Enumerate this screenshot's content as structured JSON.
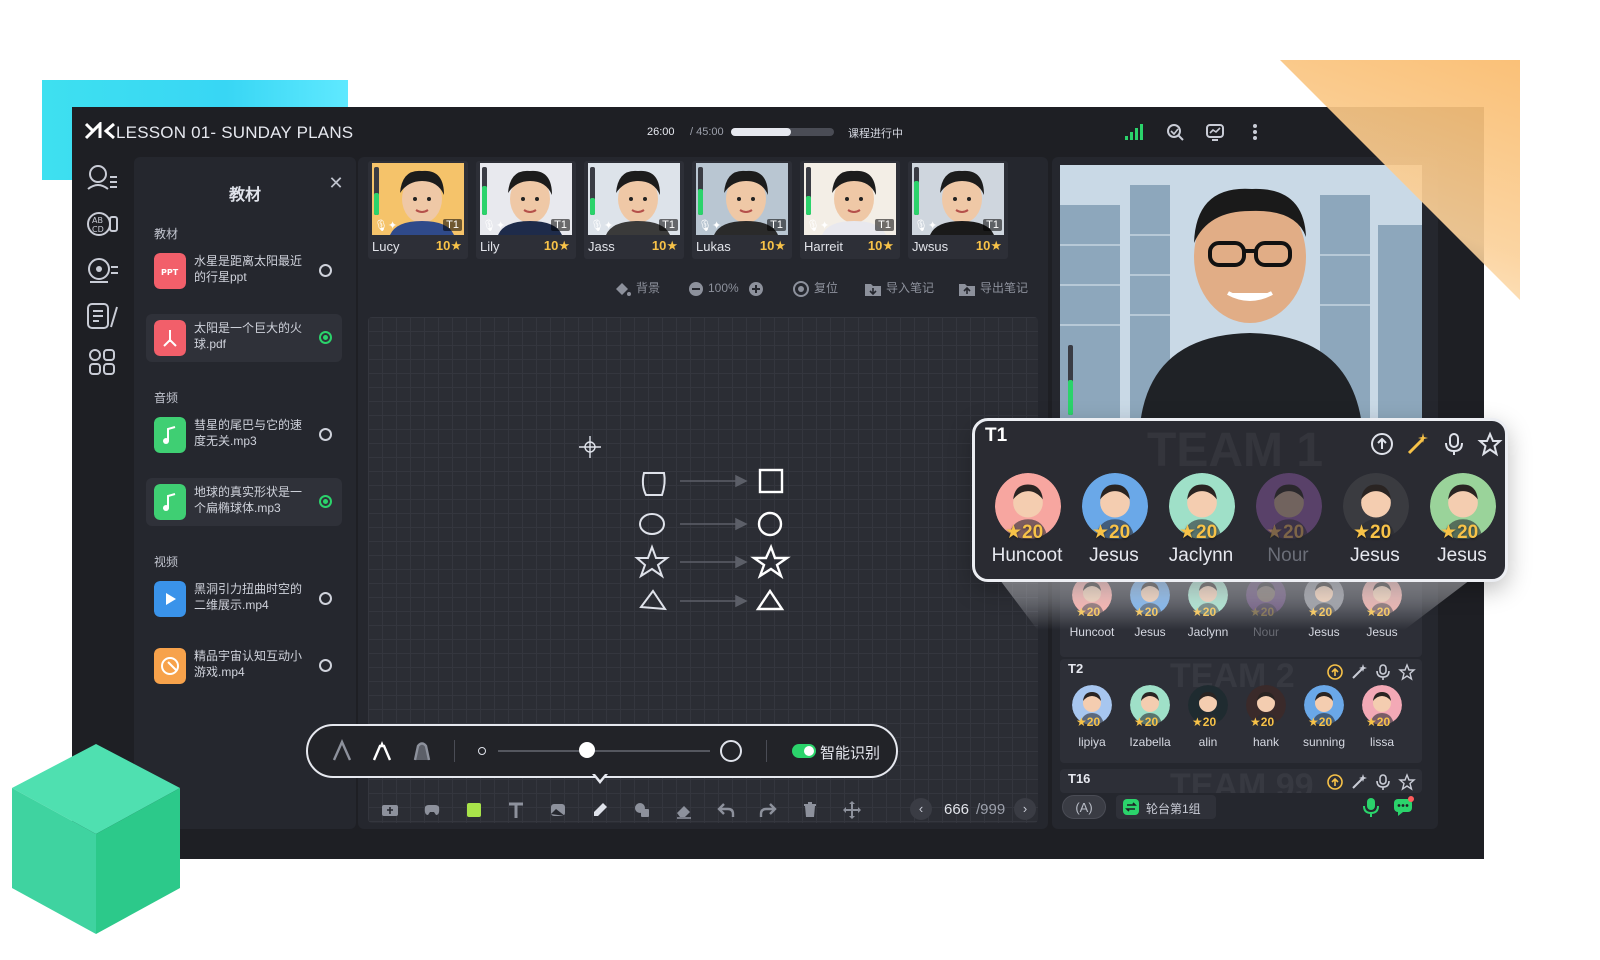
{
  "window": {
    "title": "LESSON 01- SUNDAY PLANS",
    "time_elapsed": "26:00",
    "time_total": "/ 45:00",
    "progress": 0.58,
    "status": "课程进行中"
  },
  "rail": {
    "icons": [
      "students-list-icon",
      "vocabulary-icon",
      "audio-settings-icon",
      "notes-edit-icon",
      "apps-grid-icon"
    ]
  },
  "materials_panel": {
    "title": "教材",
    "sections": [
      {
        "label": "教材",
        "items": [
          {
            "name": "水星是距离太阳最近的行星ppt",
            "type": "ppt",
            "selected": false
          },
          {
            "name": "太阳是一个巨大的火球.pdf",
            "type": "pdf",
            "selected": true
          }
        ]
      },
      {
        "label": "音频",
        "items": [
          {
            "name": "彗星的尾巴与它的速度无关.mp3",
            "type": "audio",
            "selected": false
          },
          {
            "name": "地球的真实形状是一个扁椭球体.mp3",
            "type": "audio",
            "selected": true
          }
        ]
      },
      {
        "label": "视频",
        "items": [
          {
            "name": "黑洞引力扭曲时空的二维展示.mp4",
            "type": "video",
            "selected": false
          },
          {
            "name": "精品宇宙认知互动小游戏.mp4",
            "type": "game",
            "selected": false
          }
        ]
      }
    ]
  },
  "students": [
    {
      "name": "Lucy",
      "score": "10",
      "team": "T1",
      "level": 0.45
    },
    {
      "name": "Lily",
      "score": "10",
      "team": "T1",
      "level": 0.6
    },
    {
      "name": "Jass",
      "score": "10",
      "team": "T1",
      "level": 0.35
    },
    {
      "name": "Lukas",
      "score": "10",
      "team": "T1",
      "level": 0.55
    },
    {
      "name": "Harreit",
      "score": "10",
      "team": "T1",
      "level": 0.4
    },
    {
      "name": "Jwsus",
      "score": "10",
      "team": "T1",
      "level": 0.7
    }
  ],
  "board_toolbar": {
    "background": "背景",
    "zoom": "100%",
    "reset": "复位",
    "import_notes": "导入笔记",
    "export_notes": "导出笔记"
  },
  "pen_popup": {
    "smart_recognition": "智能识别",
    "smart_on": true,
    "size": 0.42
  },
  "pager": {
    "current": "666",
    "total": "/999"
  },
  "t1_popup": {
    "label": "T1",
    "watermark": "TEAM 1",
    "members": [
      {
        "name": "Huncoot",
        "score": "20",
        "color": "#f7a6a0",
        "faded": false
      },
      {
        "name": "Jesus",
        "score": "20",
        "color": "#6aa8e8",
        "faded": false
      },
      {
        "name": "Jaclynn",
        "score": "20",
        "color": "#9fe0c8",
        "faded": false
      },
      {
        "name": "Nour",
        "score": "20",
        "color": "#b06ad0",
        "faded": true
      },
      {
        "name": "Jesus",
        "score": "20",
        "color": "#3a3b40",
        "faded": false
      },
      {
        "name": "Jesus",
        "score": "20",
        "color": "#9ad39a",
        "faded": false
      }
    ]
  },
  "teams": [
    {
      "label": "T1",
      "watermark": "",
      "members": [
        {
          "name": "Huncoot",
          "score": "20",
          "color": "#f7a6a0",
          "faded": false
        },
        {
          "name": "Jesus",
          "score": "20",
          "color": "#6aa8e8",
          "faded": false
        },
        {
          "name": "Jaclynn",
          "score": "20",
          "color": "#9fe0c8",
          "faded": false
        },
        {
          "name": "Nour",
          "score": "20",
          "color": "#b06ad0",
          "faded": true
        },
        {
          "name": "Jesus",
          "score": "20",
          "color": "#8a8c94",
          "faded": false
        },
        {
          "name": "Jesus",
          "score": "20",
          "color": "#e8a6a0",
          "faded": false
        }
      ]
    },
    {
      "label": "T2",
      "watermark": "TEAM 2",
      "members": [
        {
          "name": "lipiya",
          "score": "20",
          "color": "#a7c6ef",
          "faded": false
        },
        {
          "name": "Izabella",
          "score": "20",
          "color": "#9fe0c8",
          "faded": false
        },
        {
          "name": "alin",
          "score": "20",
          "color": "#1f2b30",
          "faded": false
        },
        {
          "name": "hank",
          "score": "20",
          "color": "#3a2a2a",
          "faded": false
        },
        {
          "name": "sunning",
          "score": "20",
          "color": "#6aa8e8",
          "faded": false
        },
        {
          "name": "lissa",
          "score": "20",
          "color": "#f3a9b6",
          "faded": false
        }
      ]
    },
    {
      "label": "T16",
      "watermark": "TEAM 99",
      "members": []
    }
  ],
  "bottom_right": {
    "mode": "(A)",
    "group": "轮台第1组"
  },
  "colors": {
    "accent_green": "#2bd36b",
    "score_gold": "#f7c248",
    "bg": "#1e1f24"
  }
}
